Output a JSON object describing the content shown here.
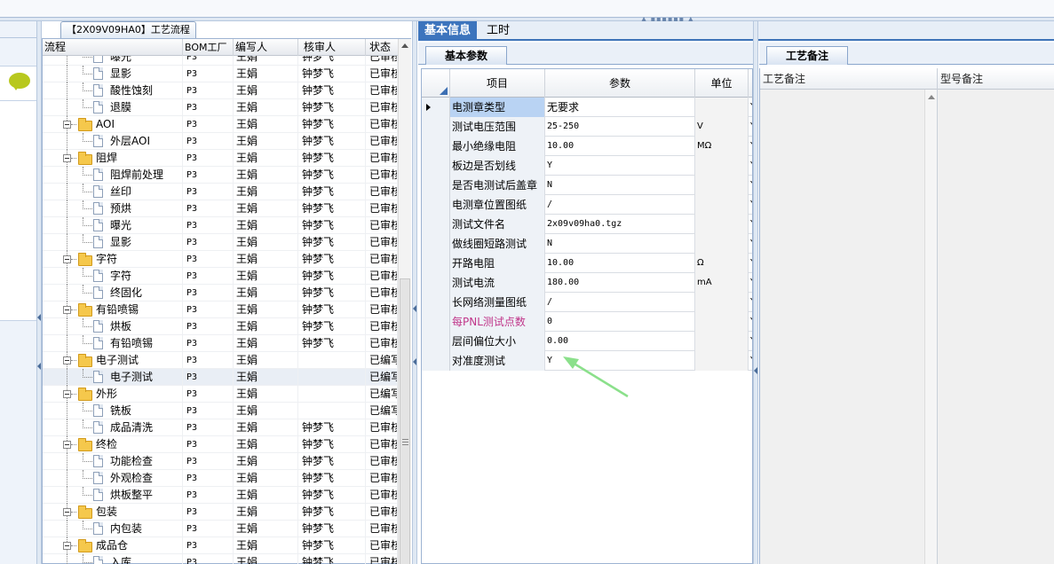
{
  "tree_panel": {
    "tab_title": "【2X09V09HA0】工艺流程",
    "columns": [
      "流程",
      "BOM工厂",
      "编写人",
      "核审人",
      "状态"
    ]
  },
  "tree_rows": [
    {
      "name": "曝光",
      "bom": "P3",
      "writer": "王娟",
      "reviewer": "钟梦飞",
      "status": "已审核",
      "level": 2
    },
    {
      "name": "显影",
      "bom": "P3",
      "writer": "王娟",
      "reviewer": "钟梦飞",
      "status": "已审核",
      "level": 2
    },
    {
      "name": "酸性蚀刻",
      "bom": "P3",
      "writer": "王娟",
      "reviewer": "钟梦飞",
      "status": "已审核",
      "level": 2
    },
    {
      "name": "退膜",
      "bom": "P3",
      "writer": "王娟",
      "reviewer": "钟梦飞",
      "status": "已审核",
      "level": 2
    },
    {
      "name": "AOI",
      "bom": "P3",
      "writer": "王娟",
      "reviewer": "钟梦飞",
      "status": "已审核",
      "level": 1
    },
    {
      "name": "外层AOI",
      "bom": "P3",
      "writer": "王娟",
      "reviewer": "钟梦飞",
      "status": "已审核",
      "level": 2
    },
    {
      "name": "阻焊",
      "bom": "P3",
      "writer": "王娟",
      "reviewer": "钟梦飞",
      "status": "已审核",
      "level": 1
    },
    {
      "name": "阻焊前处理",
      "bom": "P3",
      "writer": "王娟",
      "reviewer": "钟梦飞",
      "status": "已审核",
      "level": 2
    },
    {
      "name": "丝印",
      "bom": "P3",
      "writer": "王娟",
      "reviewer": "钟梦飞",
      "status": "已审核",
      "level": 2
    },
    {
      "name": "预烘",
      "bom": "P3",
      "writer": "王娟",
      "reviewer": "钟梦飞",
      "status": "已审核",
      "level": 2
    },
    {
      "name": "曝光",
      "bom": "P3",
      "writer": "王娟",
      "reviewer": "钟梦飞",
      "status": "已审核",
      "level": 2
    },
    {
      "name": "显影",
      "bom": "P3",
      "writer": "王娟",
      "reviewer": "钟梦飞",
      "status": "已审核",
      "level": 2
    },
    {
      "name": "字符",
      "bom": "P3",
      "writer": "王娟",
      "reviewer": "钟梦飞",
      "status": "已审核",
      "level": 1
    },
    {
      "name": "字符",
      "bom": "P3",
      "writer": "王娟",
      "reviewer": "钟梦飞",
      "status": "已审核",
      "level": 2
    },
    {
      "name": "终固化",
      "bom": "P3",
      "writer": "王娟",
      "reviewer": "钟梦飞",
      "status": "已审核",
      "level": 2
    },
    {
      "name": "有铅喷锡",
      "bom": "P3",
      "writer": "王娟",
      "reviewer": "钟梦飞",
      "status": "已审核",
      "level": 1
    },
    {
      "name": "烘板",
      "bom": "P3",
      "writer": "王娟",
      "reviewer": "钟梦飞",
      "status": "已审核",
      "level": 2
    },
    {
      "name": "有铅喷锡",
      "bom": "P3",
      "writer": "王娟",
      "reviewer": "钟梦飞",
      "status": "已审核",
      "level": 2
    },
    {
      "name": "电子测试",
      "bom": "P3",
      "writer": "王娟",
      "reviewer": "",
      "status": "已编写",
      "level": 1
    },
    {
      "name": "电子测试",
      "bom": "P3",
      "writer": "王娟",
      "reviewer": "",
      "status": "已编写",
      "level": 2,
      "selected": true
    },
    {
      "name": "外形",
      "bom": "P3",
      "writer": "王娟",
      "reviewer": "",
      "status": "已编写",
      "level": 1
    },
    {
      "name": "铣板",
      "bom": "P3",
      "writer": "王娟",
      "reviewer": "",
      "status": "已编写",
      "level": 2
    },
    {
      "name": "成品清洗",
      "bom": "P3",
      "writer": "王娟",
      "reviewer": "钟梦飞",
      "status": "已审核",
      "level": 2
    },
    {
      "name": "终检",
      "bom": "P3",
      "writer": "王娟",
      "reviewer": "钟梦飞",
      "status": "已审核",
      "level": 1
    },
    {
      "name": "功能检查",
      "bom": "P3",
      "writer": "王娟",
      "reviewer": "钟梦飞",
      "status": "已审核",
      "level": 2
    },
    {
      "name": "外观检查",
      "bom": "P3",
      "writer": "王娟",
      "reviewer": "钟梦飞",
      "status": "已审核",
      "level": 2
    },
    {
      "name": "烘板整平",
      "bom": "P3",
      "writer": "王娟",
      "reviewer": "钟梦飞",
      "status": "已审核",
      "level": 2
    },
    {
      "name": "包装",
      "bom": "P3",
      "writer": "王娟",
      "reviewer": "钟梦飞",
      "status": "已审核",
      "level": 1
    },
    {
      "name": "内包装",
      "bom": "P3",
      "writer": "王娟",
      "reviewer": "钟梦飞",
      "status": "已审核",
      "level": 2
    },
    {
      "name": "成品仓",
      "bom": "P3",
      "writer": "王娟",
      "reviewer": "钟梦飞",
      "status": "已审核",
      "level": 1
    },
    {
      "name": "入库",
      "bom": "P3",
      "writer": "王娟",
      "reviewer": "钟梦飞",
      "status": "已审核",
      "level": 2
    }
  ],
  "main_tabs": [
    "基本信息",
    "工时"
  ],
  "params": {
    "sub_tab": "基本参数",
    "columns": [
      "项目",
      "参数",
      "单位"
    ],
    "rows": [
      {
        "item": "电测章类型",
        "value": "无要求",
        "unit": "",
        "extra": "Y"
      },
      {
        "item": "测试电压范围",
        "value": "25-250",
        "unit": "V",
        "extra": "Y"
      },
      {
        "item": "最小绝缘电阻",
        "value": "10.00",
        "unit": "MΩ",
        "extra": "Y"
      },
      {
        "item": "板边是否划线",
        "value": "Y",
        "unit": "",
        "extra": "Y"
      },
      {
        "item": "是否电测试后盖章",
        "value": "N",
        "unit": "",
        "extra": "Y"
      },
      {
        "item": "电测章位置图纸",
        "value": "/",
        "unit": "",
        "extra": "Y"
      },
      {
        "item": "测试文件名",
        "value": "2x09v09ha0.tgz",
        "unit": "",
        "extra": "Y"
      },
      {
        "item": "做线圈短路测试",
        "value": "N",
        "unit": "",
        "extra": "Y"
      },
      {
        "item": "开路电阻",
        "value": "10.00",
        "unit": "Ω",
        "extra": "Y"
      },
      {
        "item": "测试电流",
        "value": "180.00",
        "unit": "mA",
        "extra": "Y"
      },
      {
        "item": "长网络测量图纸",
        "value": "/",
        "unit": "",
        "extra": "Y"
      },
      {
        "item": "每PNL测试点数",
        "value": "0",
        "unit": "",
        "extra": "Y",
        "highlight": true
      },
      {
        "item": "层间偏位大小",
        "value": "0.00",
        "unit": "",
        "extra": "Y"
      },
      {
        "item": "对准度测试",
        "value": "Y",
        "unit": "",
        "extra": "Y"
      }
    ]
  },
  "notes": {
    "sub_tab": "工艺备注",
    "col1": "工艺备注",
    "col2": "型号备注"
  },
  "colors": {
    "accent": "#3c74bd",
    "selected_cell": "#b9d3f3",
    "highlight_text": "#c0368a",
    "annotation_arrow": "#8be08b"
  }
}
